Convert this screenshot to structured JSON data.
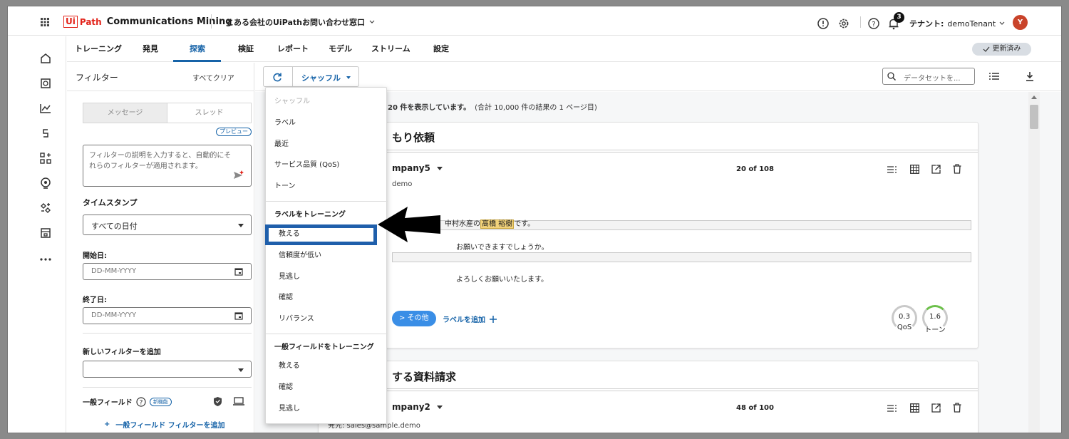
{
  "app": {
    "brand_box": "Ui",
    "brand_word": "Path",
    "product": "Communications Mining",
    "workspace": "とある会社のUiPathお問い合わせ窓口",
    "notifications": "3",
    "tenant_label": "テナント:",
    "tenant_name": "demoTenant",
    "avatar_initial": "Y"
  },
  "tabs": [
    "トレーニング",
    "発見",
    "探索",
    "検証",
    "レポート",
    "モデル",
    "ストリーム",
    "設定"
  ],
  "active_tab": "探索",
  "updated_badge": "更新済み",
  "filters": {
    "title": "フィルター",
    "clear_all": "すべてクリア",
    "seg_message": "メッセージ",
    "seg_thread": "スレッド",
    "preview": "プレビュー",
    "nl_placeholder": "フィルターの説明を入力すると、自動的にそれらのフィルターが適用されます。",
    "timestamp_label": "タイムスタンプ",
    "timestamp_value": "すべての日付",
    "start_label": "開始日:",
    "end_label": "終了日:",
    "date_placeholder": "DD-MM-YYYY",
    "new_filter_label": "新しいフィルターを追加",
    "general_field_label": "一般フィールド",
    "new_badge": "新機能",
    "add_general_filter": "一般フィールド フィルターを追加"
  },
  "toolbar": {
    "shuffle": "シャッフル",
    "search_placeholder": "データセットを..."
  },
  "results": {
    "summary_prefix": "20 件を表示しています。",
    "summary_total": "(合計 10,000 件の結果の 1 ページ目)"
  },
  "cards": [
    {
      "title": "もり依頼",
      "sender": "mpany5",
      "address": "demo",
      "position": "20 of 108",
      "line1_pre": "中村水産の",
      "line1_hl": "高橋 裕樹",
      "line1_post": "です。",
      "line2": "お願いできますでしょうか。",
      "line3": "よろしくお願いいたします。",
      "chip": "> その他",
      "add_label": "ラベルを追加",
      "qos_value": "0.3",
      "qos_label": "QoS",
      "tone_value": "1.6",
      "tone_label": "トーン"
    },
    {
      "title": "する資料請求",
      "sender": "mpany2",
      "address": "発先: sales@sample.demo",
      "position": "48 of 100"
    }
  ],
  "dropdown": {
    "section1": "シャッフル",
    "items1": [
      "ラベル",
      "最近",
      "サービス品質 (QoS)",
      "トーン"
    ],
    "section2": "ラベルをトレーニング",
    "items2": [
      "教える",
      "信頼度が低い",
      "見逃し",
      "確認",
      "リバランス"
    ],
    "section3": "一般フィールドをトレーニング",
    "items3": [
      "教える",
      "確認",
      "見逃し"
    ]
  },
  "colors": {
    "accent": "#1663a8",
    "brand_red": "#e2231a",
    "highlight_box": "#1f5fab",
    "chip_blue": "#3a8ee6"
  }
}
